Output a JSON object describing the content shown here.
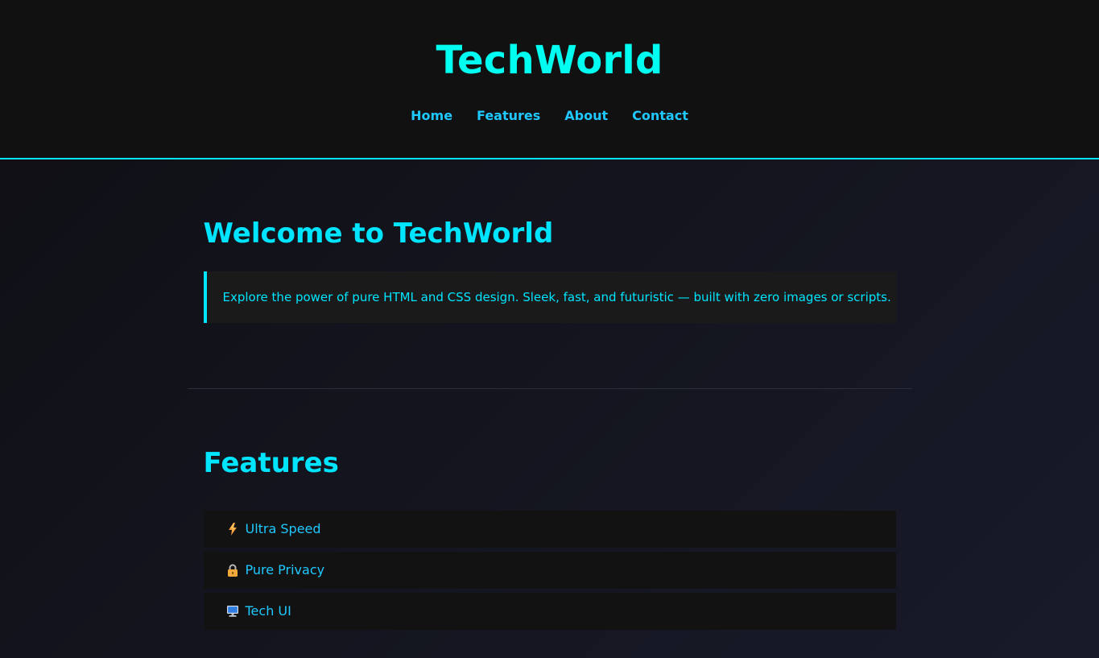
{
  "header": {
    "title": "TechWorld",
    "nav": [
      {
        "label": "Home"
      },
      {
        "label": "Features"
      },
      {
        "label": "About"
      },
      {
        "label": "Contact"
      }
    ]
  },
  "welcome": {
    "title": "Welcome to TechWorld",
    "callout": "Explore the power of pure HTML and CSS design. Sleek, fast, and futuristic — built with zero images or scripts."
  },
  "features": {
    "title": "Features",
    "items": [
      {
        "icon": "lightning-icon",
        "label": "Ultra Speed"
      },
      {
        "icon": "lock-icon",
        "label": "Pure Privacy"
      },
      {
        "icon": "computer-icon",
        "label": "Tech UI"
      }
    ]
  },
  "colors": {
    "accent": "#00e5ff",
    "title": "#00fff0",
    "nav": "#1fc8ff",
    "header_bg": "#111111",
    "callout_bg": "#1a1a1a"
  }
}
